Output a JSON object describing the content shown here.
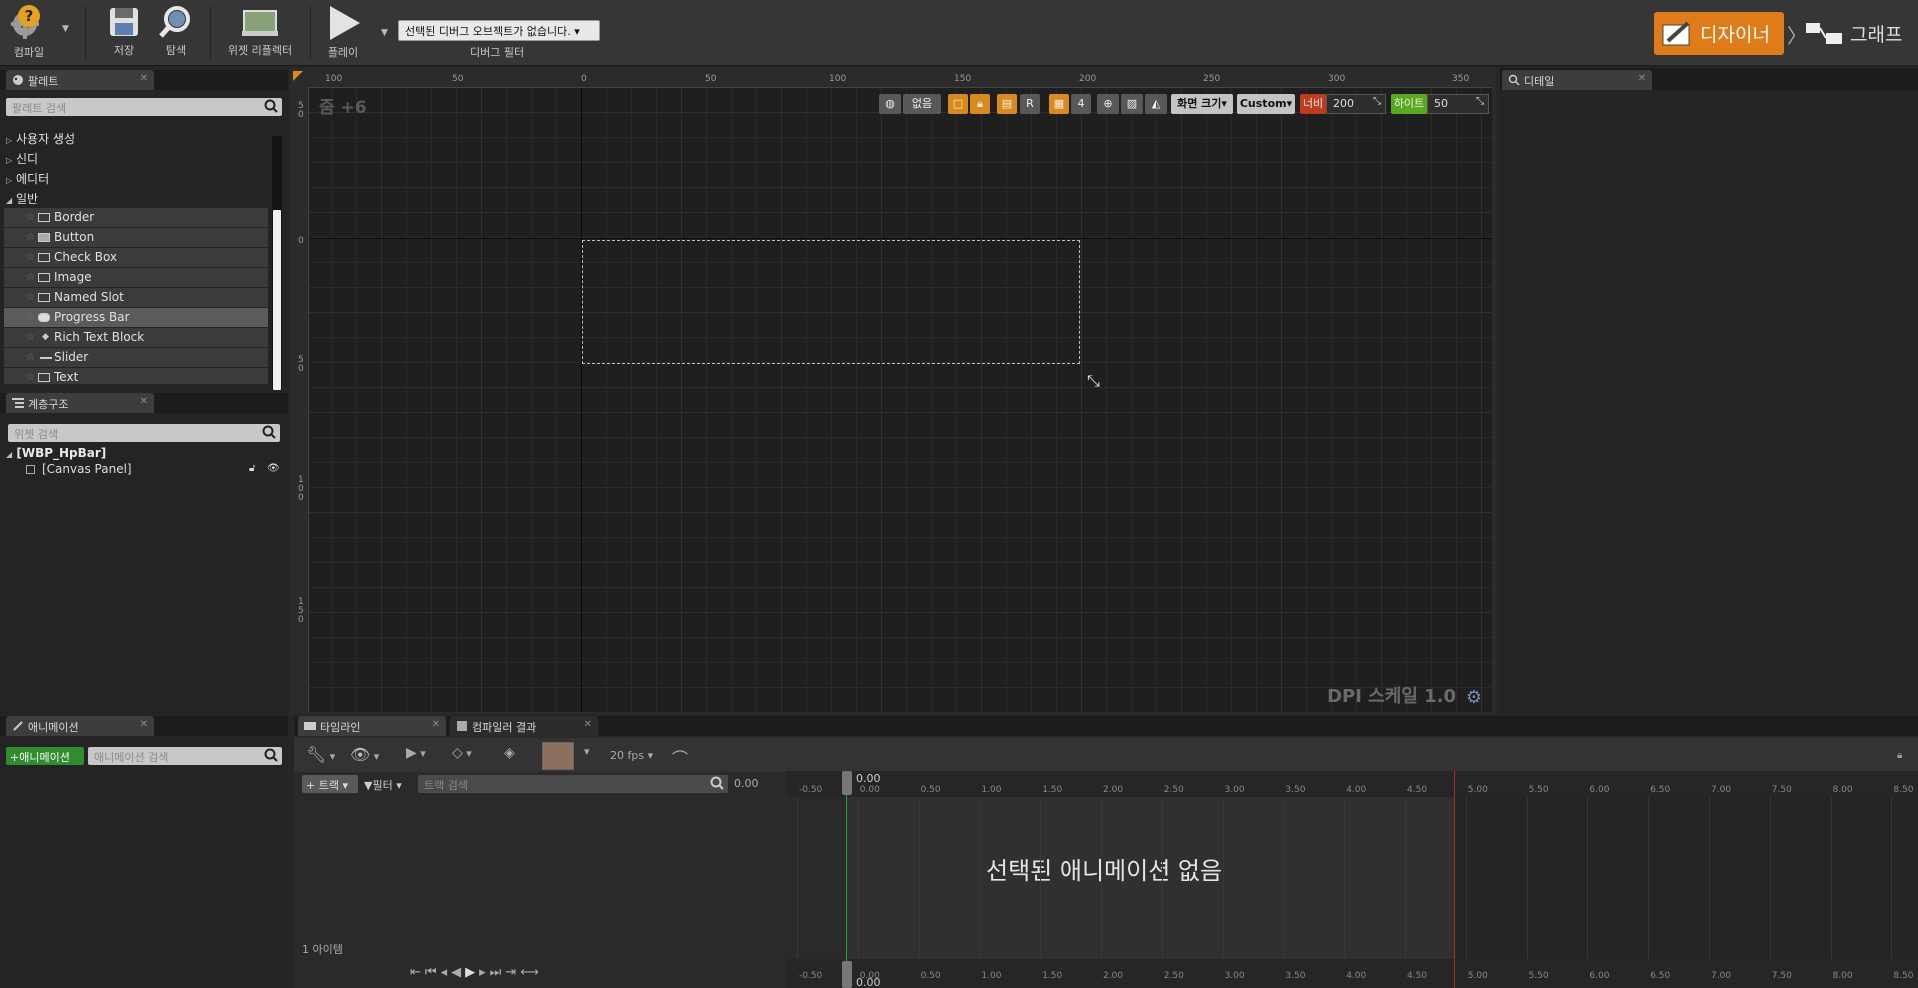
{
  "toolbar": {
    "compile": "컴파일",
    "save": "저장",
    "browse": "탐색",
    "widget_reflector": "위젯 리플렉터",
    "play": "플레이",
    "debug_object": "선택된 디버그 오브젝트가 없습니다.",
    "debug_filter": "디버그 필터",
    "designer": "디자이너",
    "graph": "그래프"
  },
  "palette": {
    "tab": "팔레트",
    "search_placeholder": "팔레트 검색",
    "categories": [
      "사용자 생성",
      "신디",
      "에디터",
      "일반"
    ],
    "items": [
      "Border",
      "Button",
      "Check Box",
      "Image",
      "Named Slot",
      "Progress Bar",
      "Rich Text Block",
      "Slider",
      "Text"
    ],
    "selected_item": "Progress Bar"
  },
  "hierarchy": {
    "tab": "계층구조",
    "search_placeholder": "위젯 검색",
    "root": "[WBP_HpBar]",
    "child": "[Canvas Panel]"
  },
  "details": {
    "tab": "디테일"
  },
  "designer": {
    "zoom": "줌 +6",
    "none_btn": "없음",
    "r_btn": "R",
    "grid_num": "4",
    "screen_size": "화면 크기",
    "custom": "Custom",
    "width_label": "너비",
    "width_value": "200",
    "height_label": "하이트",
    "height_value": "50",
    "dpi": "DPI 스케일 1.0",
    "ruler_top": [
      "100",
      "50",
      "0",
      "50",
      "100",
      "150",
      "200",
      "250",
      "300",
      "350"
    ],
    "ruler_left": [
      "5\n0",
      "0",
      "5\n0",
      "1\n0\n0",
      "1\n5\n0"
    ]
  },
  "animations": {
    "tab": "애니메이션",
    "add_button": "+애니메이션",
    "search_placeholder": "애니메이션 검색"
  },
  "timeline": {
    "tab": "타임라인",
    "compiler_tab": "컴파일러 결과",
    "fps": "20 fps",
    "track_button": "트랙",
    "filter_button": "필터",
    "search_placeholder": "트랙 검색",
    "time_value": "0.00",
    "no_animation": "선택된 애니메이션 없음",
    "item_count": "1 아이템",
    "ticks": [
      "-0.50",
      "0.00",
      "0.50",
      "1.00",
      "1.50",
      "2.00",
      "2.50",
      "3.00",
      "3.50",
      "4.00",
      "4.50",
      "5.00",
      "5.50",
      "6.00",
      "6.50",
      "7.00",
      "7.50",
      "8.00",
      "8.50"
    ],
    "playhead": "0.00"
  },
  "colors": {
    "accent": "#e07b1a",
    "width_badge": "#c23a1e",
    "height_badge": "#5aa81e",
    "add_anim": "#2f8c2f"
  }
}
